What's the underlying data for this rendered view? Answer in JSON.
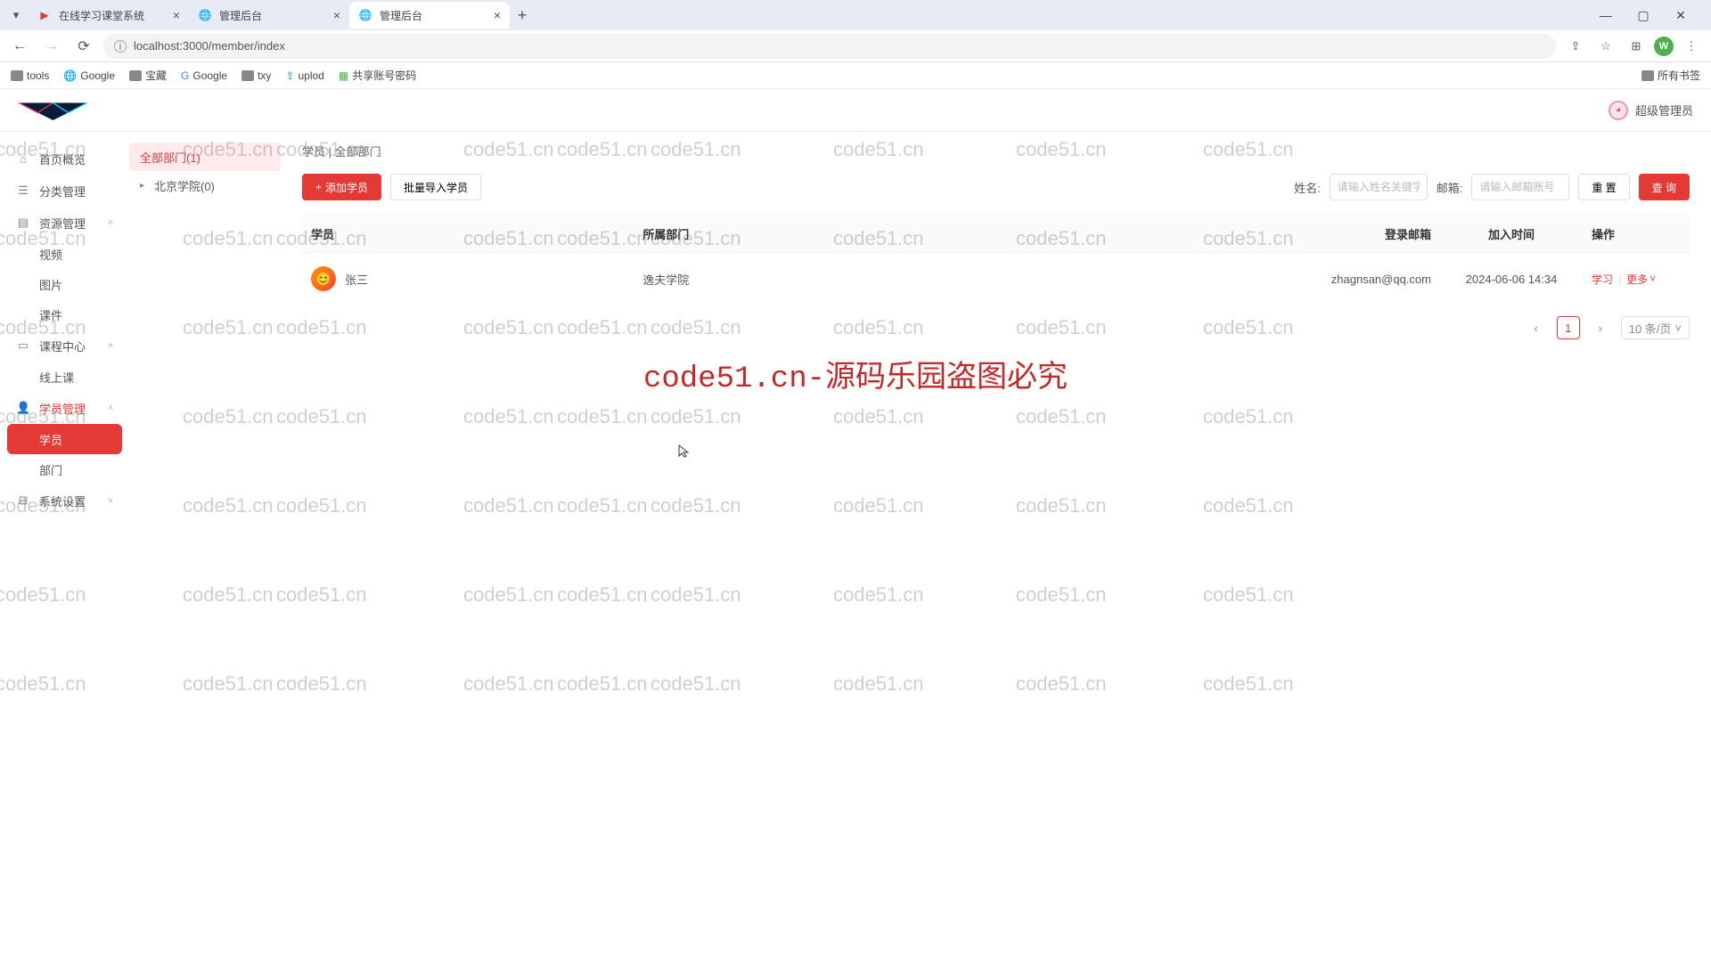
{
  "browser": {
    "tabs": [
      {
        "title": "在线学习课堂系统",
        "active": false,
        "favicon": "red"
      },
      {
        "title": "管理后台",
        "active": false,
        "favicon": "globe"
      },
      {
        "title": "管理后台",
        "active": true,
        "favicon": "globe"
      }
    ],
    "url": "localhost:3000/member/index",
    "bookmarks": [
      "tools",
      "Google",
      "宝藏",
      "Google",
      "txy",
      "uplod",
      "共享账号密码"
    ],
    "all_bookmarks_label": "所有书签",
    "profile_letter": "W"
  },
  "header": {
    "user_label": "超级管理员"
  },
  "sidebar": {
    "items": [
      {
        "icon": "home",
        "label": "首页概览",
        "expandable": false
      },
      {
        "icon": "category",
        "label": "分类管理",
        "expandable": false
      },
      {
        "icon": "resource",
        "label": "资源管理",
        "expandable": true,
        "expanded": true,
        "children": [
          "视频",
          "图片",
          "课件"
        ]
      },
      {
        "icon": "course",
        "label": "课程中心",
        "expandable": true,
        "expanded": true,
        "children": [
          "线上课"
        ]
      },
      {
        "icon": "member",
        "label": "学员管理",
        "expandable": true,
        "expanded": true,
        "active": true,
        "children_active": "学员",
        "children": [
          "学员",
          "部门"
        ]
      },
      {
        "icon": "settings",
        "label": "系统设置",
        "expandable": true,
        "expanded": false
      }
    ]
  },
  "dept_tree": {
    "root": "全部部门(1)",
    "children": [
      "北京学院(0)"
    ]
  },
  "main": {
    "breadcrumb_left": "学员",
    "breadcrumb_sep": " | ",
    "breadcrumb_right": "全部部门",
    "add_button": "添加学员",
    "bulk_import_button": "批量导入学员",
    "filter_name_label": "姓名:",
    "filter_name_placeholder": "请输入姓名关键字",
    "filter_email_label": "邮箱:",
    "filter_email_placeholder": "请输入邮箱账号",
    "reset_button": "重 置",
    "query_button": "查 询",
    "table": {
      "headers": [
        "学员",
        "所属部门",
        "登录邮箱",
        "加入时间",
        "操作"
      ],
      "rows": [
        {
          "name": "张三",
          "dept": "逸夫学院",
          "email": "zhagnsan@qq.com",
          "joined": "2024-06-06 14:34"
        }
      ],
      "action_study": "学习",
      "action_more": "更多"
    },
    "pagination": {
      "current": "1",
      "page_size_label": "10 条/页"
    }
  },
  "watermark": {
    "text": "code51.cn",
    "big_text": "code51.cn-源码乐园盗图必究"
  }
}
